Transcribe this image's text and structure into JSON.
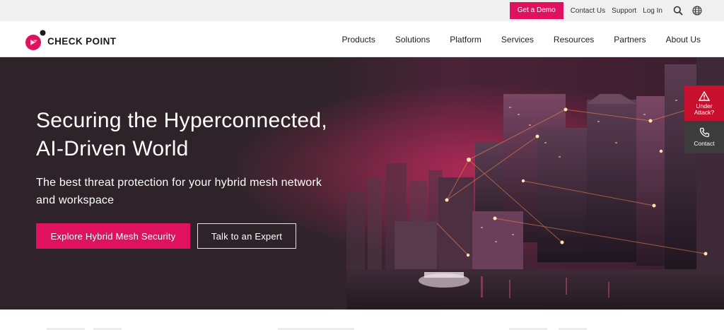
{
  "utility": {
    "demo_label": "Get a Demo",
    "links": [
      "Contact Us",
      "Support",
      "Log In"
    ],
    "icons": [
      "search-icon",
      "globe-icon"
    ]
  },
  "brand": {
    "name": "CHECK POINT",
    "accent": "#e0125f"
  },
  "nav": {
    "items": [
      "Products",
      "Solutions",
      "Platform",
      "Services",
      "Resources",
      "Partners",
      "About Us"
    ]
  },
  "hero": {
    "title_line1": "Securing the Hyperconnected,",
    "title_line2": "AI-Driven World",
    "subtitle_line1": "The best threat protection for your hybrid mesh network",
    "subtitle_line2": "and workspace",
    "primary_cta": "Explore Hybrid Mesh Security",
    "secondary_cta": "Talk to an Expert"
  },
  "side_widget": {
    "under_attack_line1": "Under",
    "under_attack_line2": "Attack?",
    "contact_label": "Contact",
    "under_attack_color": "#c8102e"
  }
}
